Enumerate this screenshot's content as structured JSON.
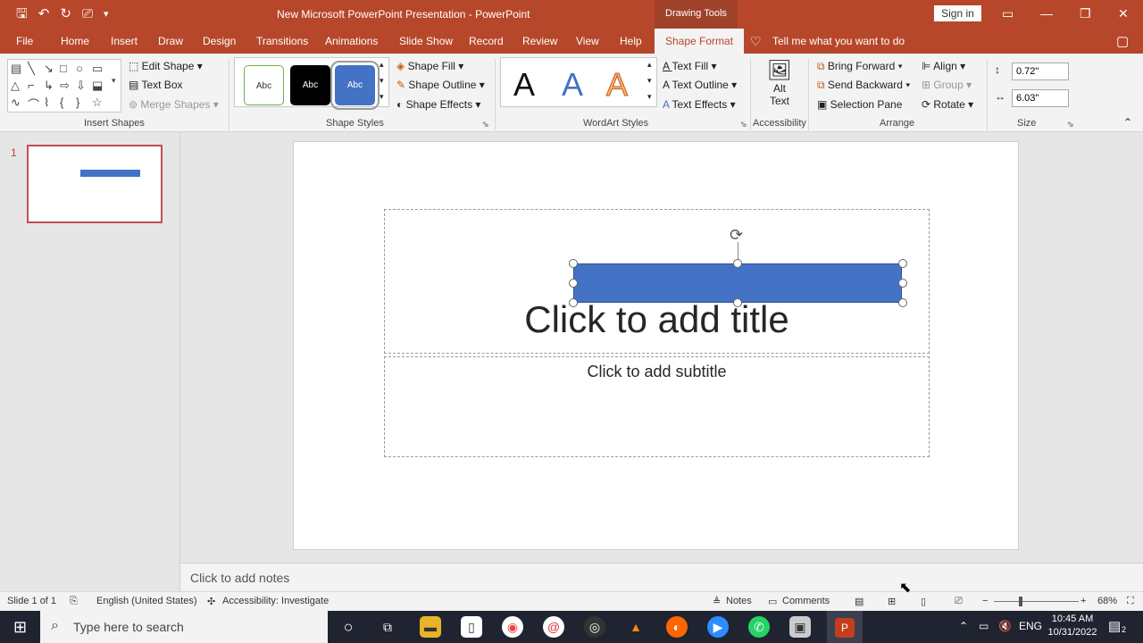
{
  "window": {
    "doc_title": "New Microsoft PowerPoint Presentation  -  PowerPoint",
    "context_title": "Drawing Tools",
    "sign_in": "Sign in",
    "qat_icons": [
      "save-icon",
      "undo-icon",
      "redo-icon",
      "present-icon",
      "customize-icon"
    ]
  },
  "menu": {
    "tabs": [
      "File",
      "Home",
      "Insert",
      "Draw",
      "Design",
      "Transitions",
      "Animations",
      "Slide Show",
      "Record",
      "Review",
      "View",
      "Help"
    ],
    "active_tab": "Shape Format",
    "tell_me": "Tell me what you want to do"
  },
  "ribbon": {
    "insert_shapes": {
      "label": "Insert Shapes",
      "edit_shape": "Edit Shape",
      "text_box": "Text Box",
      "merge_shapes": "Merge Shapes"
    },
    "shape_styles": {
      "label": "Shape Styles",
      "swatches": [
        "Abc",
        "Abc",
        "Abc"
      ],
      "fill": "Shape Fill",
      "outline": "Shape Outline",
      "effects": "Shape Effects"
    },
    "wordart": {
      "label": "WordArt Styles",
      "letters": [
        "A",
        "A",
        "A"
      ],
      "text_fill": "Text Fill",
      "text_outline": "Text Outline",
      "text_effects": "Text Effects"
    },
    "accessibility": {
      "label": "Accessibility",
      "alt_text_1": "Alt",
      "alt_text_2": "Text"
    },
    "arrange": {
      "label": "Arrange",
      "bring_forward": "Bring Forward",
      "send_backward": "Send Backward",
      "selection_pane": "Selection Pane",
      "align": "Align",
      "group": "Group",
      "rotate": "Rotate"
    },
    "size": {
      "label": "Size",
      "height": "0.72\"",
      "width": "6.03\""
    }
  },
  "thumbs": {
    "slide_number": "1"
  },
  "slide": {
    "title_placeholder": "Click to add title",
    "subtitle_placeholder": "Click to add subtitle"
  },
  "notes": {
    "placeholder": "Click to add notes"
  },
  "status": {
    "slide_of": "Slide 1 of 1",
    "language": "English (United States)",
    "accessibility": "Accessibility: Investigate",
    "notes": "Notes",
    "comments": "Comments",
    "zoom": "68%"
  },
  "taskbar": {
    "search_placeholder": "Type here to search",
    "lang": "ENG",
    "time": "10:45 AM",
    "date": "10/31/2022",
    "notification_count": "2"
  },
  "colors": {
    "accent": "#b7472a",
    "shape_fill": "#4472c4"
  }
}
